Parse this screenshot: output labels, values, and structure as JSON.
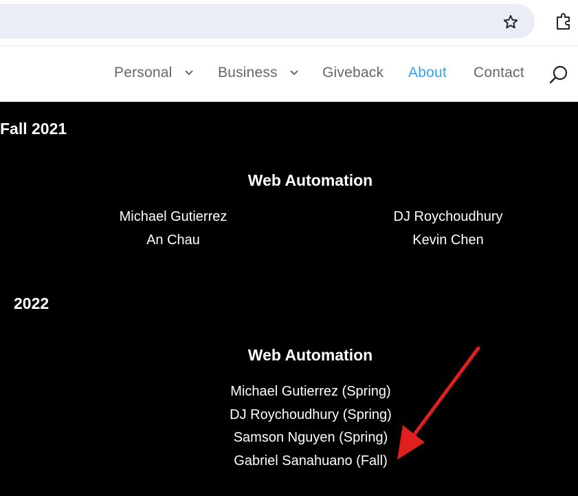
{
  "nav": {
    "items": [
      {
        "label": "Personal",
        "has_dropdown": true
      },
      {
        "label": "Business",
        "has_dropdown": true
      },
      {
        "label": "Giveback",
        "has_dropdown": false
      },
      {
        "label": "About",
        "has_dropdown": false,
        "active": true
      },
      {
        "label": "Contact",
        "has_dropdown": false
      }
    ],
    "active_color": "#2ea3f2",
    "icons": [
      "star-icon",
      "extensions-icon",
      "search-icon"
    ]
  },
  "sections": [
    {
      "year": "Fall 2021",
      "group": "Web Automation",
      "left_names": [
        "Michael Gutierrez",
        "An Chau"
      ],
      "right_names": [
        "DJ Roychoudhury",
        "Kevin Chen"
      ]
    },
    {
      "year": "2022",
      "group": "Web Automation",
      "names": [
        "Michael Gutierrez (Spring)",
        "DJ Roychoudhury (Spring)",
        "Samson Nguyen (Spring)",
        "Gabriel Sanahuano (Fall)"
      ]
    }
  ],
  "annotation": {
    "type": "arrow",
    "color": "#e0201c"
  }
}
